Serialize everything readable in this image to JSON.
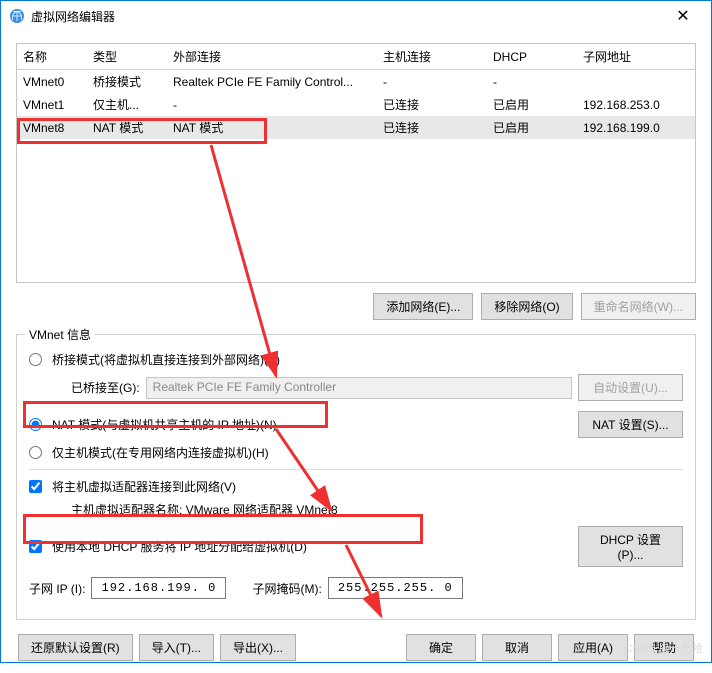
{
  "window": {
    "title": "虚拟网络编辑器"
  },
  "table": {
    "headers": [
      "名称",
      "类型",
      "外部连接",
      "主机连接",
      "DHCP",
      "子网地址"
    ],
    "rows": [
      {
        "name": "VMnet0",
        "type": "桥接模式",
        "ext": "Realtek PCIe FE Family Control...",
        "host": "-",
        "dhcp": "-",
        "subnet": ""
      },
      {
        "name": "VMnet1",
        "type": "仅主机...",
        "ext": "-",
        "host": "已连接",
        "dhcp": "已启用",
        "subnet": "192.168.253.0"
      },
      {
        "name": "VMnet8",
        "type": "NAT 模式",
        "ext": "NAT 模式",
        "host": "已连接",
        "dhcp": "已启用",
        "subnet": "192.168.199.0"
      }
    ]
  },
  "netButtons": {
    "add": "添加网络(E)...",
    "remove": "移除网络(O)",
    "rename": "重命名网络(W)..."
  },
  "group": {
    "legend": "VMnet 信息",
    "bridge": {
      "label": "桥接模式(将虚拟机直接连接到外部网络)(B)",
      "bridgedToLabel": "已桥接至(G):",
      "bridgedToValue": "Realtek PCIe FE Family Controller",
      "auto": "自动设置(U)..."
    },
    "nat": {
      "label": "NAT 模式(与虚拟机共享主机的 IP 地址)(N)",
      "settings": "NAT 设置(S)..."
    },
    "hostonly": {
      "label": "仅主机模式(在专用网络内连接虚拟机)(H)"
    },
    "hostConnect": {
      "label": "将主机虚拟适配器连接到此网络(V)",
      "adapterLabel": "主机虚拟适配器名称: VMware 网络适配器 VMnet8"
    },
    "dhcp": {
      "label": "使用本地 DHCP 服务将 IP 地址分配给虚拟机(D)",
      "settings": "DHCP 设置(P)..."
    },
    "subnet": {
      "ipLabel": "子网 IP (I):",
      "ipValue": "192.168.199. 0",
      "maskLabel": "子网掩码(M):",
      "maskValue": "255.255.255. 0"
    }
  },
  "bottom": {
    "restore": "还原默认设置(R)",
    "import": "导入(T)...",
    "export": "导出(X)...",
    "ok": "确定",
    "cancel": "取消",
    "apply": "应用(A)",
    "help": "帮助"
  },
  "watermark": "CSDN @十七拾"
}
